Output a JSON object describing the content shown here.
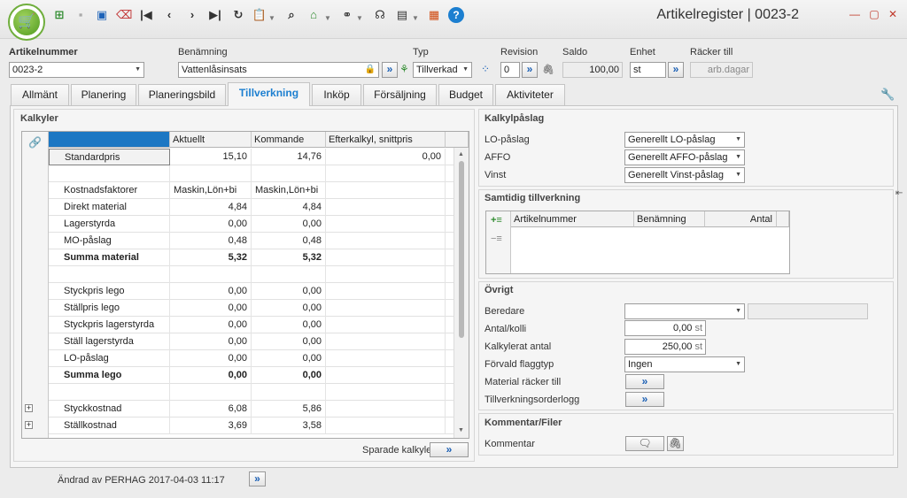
{
  "window": {
    "title": "Artikelregister | 0023-2"
  },
  "header": {
    "artikelnummer_label": "Artikelnummer",
    "artikelnummer_value": "0023-2",
    "benamning_label": "Benämning",
    "benamning_value": "Vattenlåsinsats",
    "typ_label": "Typ",
    "typ_value": "Tillverkad",
    "revision_label": "Revision",
    "revision_value": "0",
    "saldo_label": "Saldo",
    "saldo_value": "100,00",
    "enhet_label": "Enhet",
    "enhet_value": "st",
    "racker_till_label": "Räcker till",
    "racker_till_value": "arb.dagar"
  },
  "tabs": [
    "Allmänt",
    "Planering",
    "Planeringsbild",
    "Tillverkning",
    "Inköp",
    "Försäljning",
    "Budget",
    "Aktiviteter"
  ],
  "active_tab": "Tillverkning",
  "kalkyler": {
    "title": "Kalkyler",
    "columns": [
      "",
      "Aktuellt",
      "Kommande",
      "Efterkalkyl, snittpris"
    ],
    "rows": [
      {
        "label": "Standardpris",
        "aktuellt": "15,10",
        "kommande": "14,76",
        "efterkalkyl": "0,00"
      },
      {
        "label": "",
        "aktuellt": "",
        "kommande": "",
        "efterkalkyl": ""
      },
      {
        "label": "Kostnadsfaktorer",
        "aktuellt": "Maskin,Lön+bi",
        "kommande": "Maskin,Lön+bi",
        "efterkalkyl": ""
      },
      {
        "label": "Direkt material",
        "aktuellt": "4,84",
        "kommande": "4,84",
        "efterkalkyl": ""
      },
      {
        "label": "Lagerstyrda",
        "aktuellt": "0,00",
        "kommande": "0,00",
        "efterkalkyl": ""
      },
      {
        "label": "MO-påslag",
        "aktuellt": "0,48",
        "kommande": "0,48",
        "efterkalkyl": ""
      },
      {
        "label": "Summa material",
        "aktuellt": "5,32",
        "kommande": "5,32",
        "efterkalkyl": ""
      },
      {
        "label": "",
        "aktuellt": "",
        "kommande": "",
        "efterkalkyl": ""
      },
      {
        "label": "Styckpris lego",
        "aktuellt": "0,00",
        "kommande": "0,00",
        "efterkalkyl": ""
      },
      {
        "label": "Ställpris lego",
        "aktuellt": "0,00",
        "kommande": "0,00",
        "efterkalkyl": ""
      },
      {
        "label": "Styckpris lagerstyrda",
        "aktuellt": "0,00",
        "kommande": "0,00",
        "efterkalkyl": ""
      },
      {
        "label": "Ställ lagerstyrda",
        "aktuellt": "0,00",
        "kommande": "0,00",
        "efterkalkyl": ""
      },
      {
        "label": "LO-påslag",
        "aktuellt": "0,00",
        "kommande": "0,00",
        "efterkalkyl": ""
      },
      {
        "label": "Summa lego",
        "aktuellt": "0,00",
        "kommande": "0,00",
        "efterkalkyl": ""
      },
      {
        "label": "",
        "aktuellt": "",
        "kommande": "",
        "efterkalkyl": ""
      },
      {
        "label": "Styckkostnad",
        "aktuellt": "6,08",
        "kommande": "5,86",
        "efterkalkyl": ""
      },
      {
        "label": "Ställkostnad",
        "aktuellt": "3,69",
        "kommande": "3,58",
        "efterkalkyl": ""
      }
    ],
    "sparade_label": "Sparade kalkyler"
  },
  "kalkylpaslag": {
    "title": "Kalkylpåslag",
    "lo_label": "LO-påslag",
    "lo_value": "Generellt LO-påslag",
    "affo_label": "AFFO",
    "affo_value": "Generellt AFFO-påslag",
    "vinst_label": "Vinst",
    "vinst_value": "Generellt Vinst-påslag"
  },
  "samtidig": {
    "title": "Samtidig tillverkning",
    "columns": [
      "Artikelnummer",
      "Benämning",
      "Antal"
    ]
  },
  "ovrigt": {
    "title": "Övrigt",
    "beredare_label": "Beredare",
    "beredare_value": "",
    "antal_kolli_label": "Antal/kolli",
    "antal_kolli_value": "0,00",
    "antal_kolli_unit": "st",
    "kalkylerat_label": "Kalkylerat antal",
    "kalkylerat_value": "250,00",
    "kalkylerat_unit": "st",
    "flaggtyp_label": "Förvald flaggtyp",
    "flaggtyp_value": "Ingen",
    "material_label": "Material räcker till",
    "tillverkningsorderlogg_label": "Tillverkningsorderlogg"
  },
  "kommentar": {
    "title": "Kommentar/Filer",
    "kommentar_label": "Kommentar"
  },
  "footer": {
    "changed_by": "Ändrad av PERHAG 2017-04-03 11:17"
  }
}
